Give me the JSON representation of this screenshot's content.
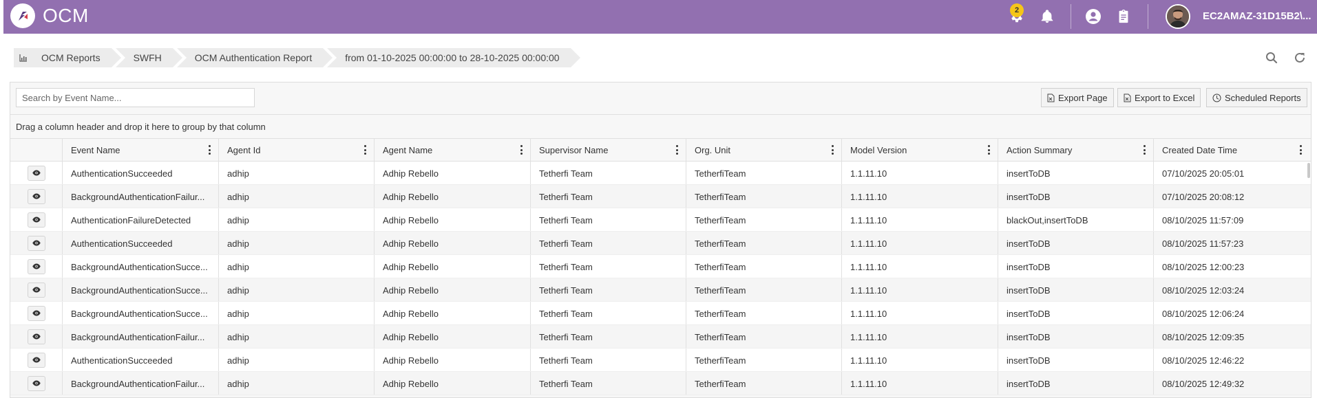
{
  "app": {
    "title": "OCM",
    "accent_color": "#9270b0",
    "notification_count": "2",
    "user_name": "EC2AMAZ-31D15B2\\..."
  },
  "breadcrumb": {
    "items": [
      "OCM Reports",
      "SWFH",
      "OCM Authentication Report",
      "from 01-10-2025 00:00:00 to 28-10-2025 00:00:00"
    ]
  },
  "toolbar": {
    "search_placeholder": "Search by Event Name...",
    "export_page": "Export Page",
    "export_excel": "Export to Excel",
    "scheduled_reports": "Scheduled Reports",
    "group_hint": "Drag a column header and drop it here to group by that column"
  },
  "table": {
    "columns": [
      "Event Name",
      "Agent Id",
      "Agent Name",
      "Supervisor Name",
      "Org. Unit",
      "Model Version",
      "Action Summary",
      "Created Date Time"
    ],
    "rows": [
      [
        "AuthenticationSucceeded",
        "adhip",
        "Adhip Rebello",
        "Tetherfi Team",
        "TetherfiTeam",
        "1.1.11.10",
        "insertToDB",
        "07/10/2025 20:05:01"
      ],
      [
        "BackgroundAuthenticationFailur...",
        "adhip",
        "Adhip Rebello",
        "Tetherfi Team",
        "TetherfiTeam",
        "1.1.11.10",
        "insertToDB",
        "07/10/2025 20:08:12"
      ],
      [
        "AuthenticationFailureDetected",
        "adhip",
        "Adhip Rebello",
        "Tetherfi Team",
        "TetherfiTeam",
        "1.1.11.10",
        "blackOut,insertToDB",
        "08/10/2025 11:57:09"
      ],
      [
        "AuthenticationSucceeded",
        "adhip",
        "Adhip Rebello",
        "Tetherfi Team",
        "TetherfiTeam",
        "1.1.11.10",
        "insertToDB",
        "08/10/2025 11:57:23"
      ],
      [
        "BackgroundAuthenticationSucce...",
        "adhip",
        "Adhip Rebello",
        "Tetherfi Team",
        "TetherfiTeam",
        "1.1.11.10",
        "insertToDB",
        "08/10/2025 12:00:23"
      ],
      [
        "BackgroundAuthenticationSucce...",
        "adhip",
        "Adhip Rebello",
        "Tetherfi Team",
        "TetherfiTeam",
        "1.1.11.10",
        "insertToDB",
        "08/10/2025 12:03:24"
      ],
      [
        "BackgroundAuthenticationSucce...",
        "adhip",
        "Adhip Rebello",
        "Tetherfi Team",
        "TetherfiTeam",
        "1.1.11.10",
        "insertToDB",
        "08/10/2025 12:06:24"
      ],
      [
        "BackgroundAuthenticationFailur...",
        "adhip",
        "Adhip Rebello",
        "Tetherfi Team",
        "TetherfiTeam",
        "1.1.11.10",
        "insertToDB",
        "08/10/2025 12:09:35"
      ],
      [
        "AuthenticationSucceeded",
        "adhip",
        "Adhip Rebello",
        "Tetherfi Team",
        "TetherfiTeam",
        "1.1.11.10",
        "insertToDB",
        "08/10/2025 12:46:22"
      ],
      [
        "BackgroundAuthenticationFailur...",
        "adhip",
        "Adhip Rebello",
        "Tetherfi Team",
        "TetherfiTeam",
        "1.1.11.10",
        "insertToDB",
        "08/10/2025 12:49:32"
      ]
    ]
  }
}
